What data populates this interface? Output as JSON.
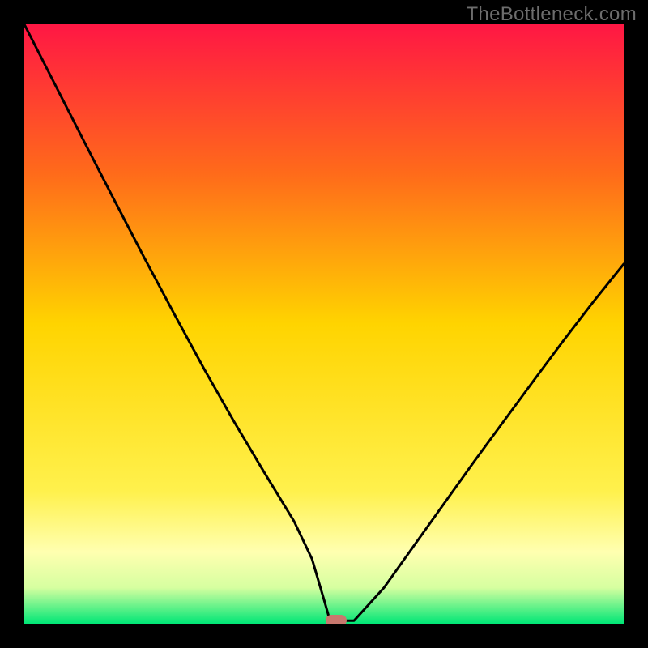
{
  "watermark": "TheBottleneck.com",
  "chart_data": {
    "type": "line",
    "title": "",
    "xlabel": "",
    "ylabel": "",
    "xlim": [
      0,
      100
    ],
    "ylim": [
      0,
      100
    ],
    "grid": false,
    "legend": false,
    "series": [
      {
        "name": "bottleneck-curve",
        "x": [
          0,
          5,
          10,
          15,
          20,
          25,
          30,
          35,
          40,
          45,
          48,
          50,
          51,
          52,
          55,
          60,
          65,
          70,
          75,
          80,
          85,
          90,
          95,
          100
        ],
        "y": [
          100,
          90.2,
          80.4,
          70.7,
          61.1,
          51.7,
          42.5,
          33.7,
          25.3,
          17.1,
          10.8,
          4.0,
          0.5,
          0.5,
          0.5,
          6.0,
          13.0,
          20.0,
          27.0,
          33.8,
          40.6,
          47.3,
          53.8,
          60.0
        ]
      }
    ],
    "marker": {
      "x": 52,
      "y": 0.5,
      "color": "#c8786e"
    },
    "background_gradient": {
      "stops": [
        {
          "offset": 0.0,
          "color": "#ff1744"
        },
        {
          "offset": 0.25,
          "color": "#ff6b1a"
        },
        {
          "offset": 0.5,
          "color": "#ffd400"
        },
        {
          "offset": 0.78,
          "color": "#fff14d"
        },
        {
          "offset": 0.88,
          "color": "#ffffb0"
        },
        {
          "offset": 0.94,
          "color": "#d6ffa0"
        },
        {
          "offset": 1.0,
          "color": "#00e676"
        }
      ]
    }
  }
}
